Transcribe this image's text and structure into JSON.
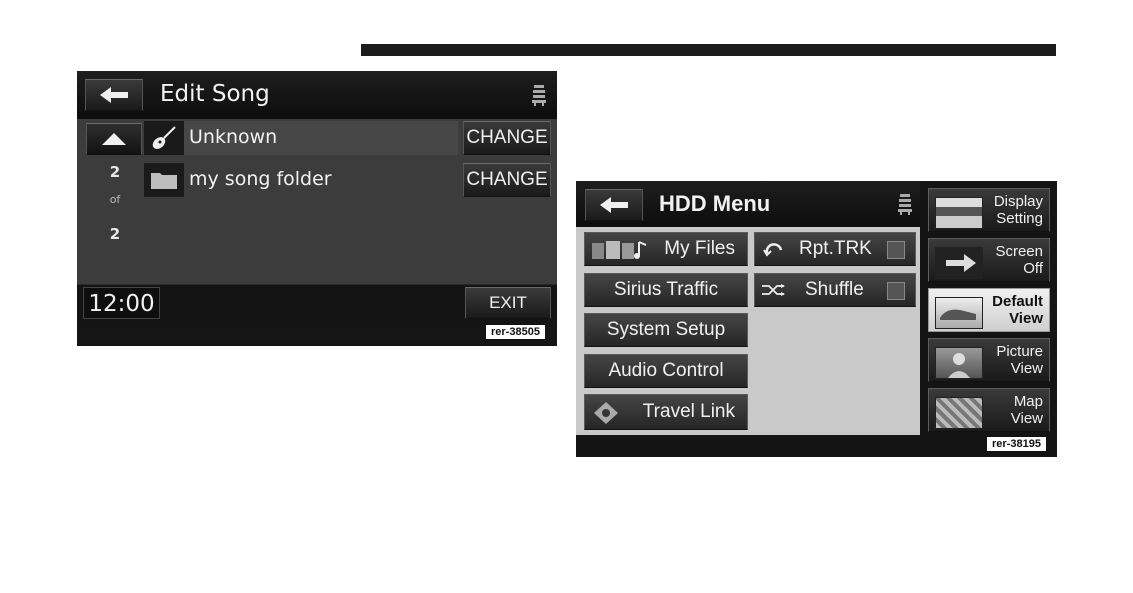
{
  "screen1": {
    "title": "Edit Song",
    "rows": [
      {
        "label": "Unknown",
        "action": "CHANGE"
      },
      {
        "label": "my song folder",
        "action": "CHANGE"
      }
    ],
    "page_current": "2",
    "page_of": "of",
    "page_total": "2",
    "clock": "12:00",
    "exit": "EXIT",
    "tag": "rer-38505"
  },
  "screen2": {
    "title": "HDD Menu",
    "menu": {
      "my_files": "My Files",
      "sirius_traffic": "Sirius Traffic",
      "system_setup": "System Setup",
      "audio_control": "Audio Control",
      "travel_link": "Travel Link",
      "rpt_trk": "Rpt.TRK",
      "shuffle": "Shuffle"
    },
    "side": [
      {
        "line1": "Display",
        "line2": "Setting"
      },
      {
        "line1": "Screen",
        "line2": "Off"
      },
      {
        "line1": "Default",
        "line2": "View"
      },
      {
        "line1": "Picture",
        "line2": "View"
      },
      {
        "line1": "Map",
        "line2": "View"
      }
    ],
    "active_side": "Default View",
    "tag": "rer-38195"
  }
}
